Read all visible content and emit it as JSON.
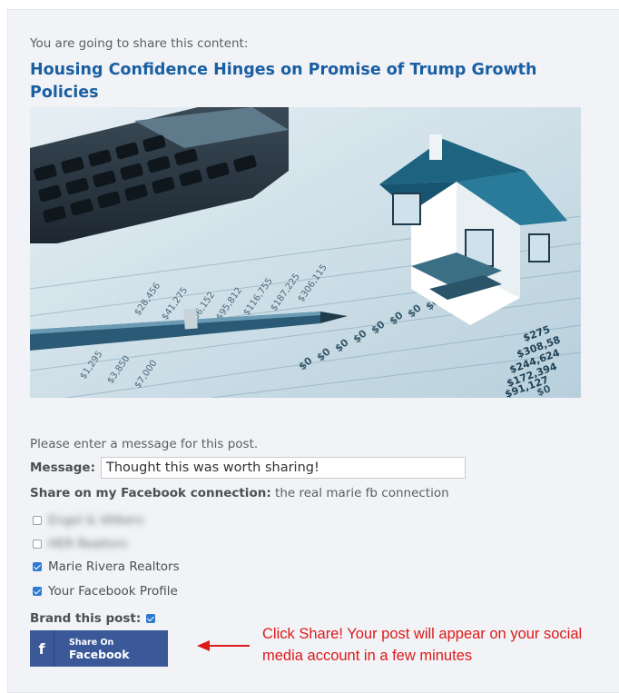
{
  "share": {
    "intro": "You are going to share this content:",
    "title": "Housing Confidence Hinges on Promise of Trump Growth Policies"
  },
  "image": {
    "icon": "house-calculator-pen-photo",
    "numbers": [
      "$275",
      "$308,58",
      "$244,624",
      "$172,394",
      "$91,127",
      "$0"
    ]
  },
  "form": {
    "prompt": "Please enter a message for this post.",
    "message_label": "Message:",
    "message_value": "Thought this was worth sharing!",
    "connection_label": "Share on my Facebook connection:",
    "connection_name": "the real marie fb connection",
    "accounts": [
      {
        "label": "Engel & Völkers",
        "checked": false,
        "blurred": true
      },
      {
        "label": "HER Realtors",
        "checked": false,
        "blurred": true
      },
      {
        "label": "Marie Rivera Realtors",
        "checked": true,
        "blurred": false
      },
      {
        "label": "Your Facebook Profile",
        "checked": true,
        "blurred": false
      }
    ],
    "brand_label": "Brand this post:",
    "brand_checked": true
  },
  "button": {
    "small": "Share On",
    "big": "Facebook",
    "icon": "facebook-f-icon",
    "color": "#3b5998"
  },
  "annotation": {
    "text": "Click Share! Your post will appear on your social media account in a few minutes",
    "color": "#dd1a1a"
  }
}
